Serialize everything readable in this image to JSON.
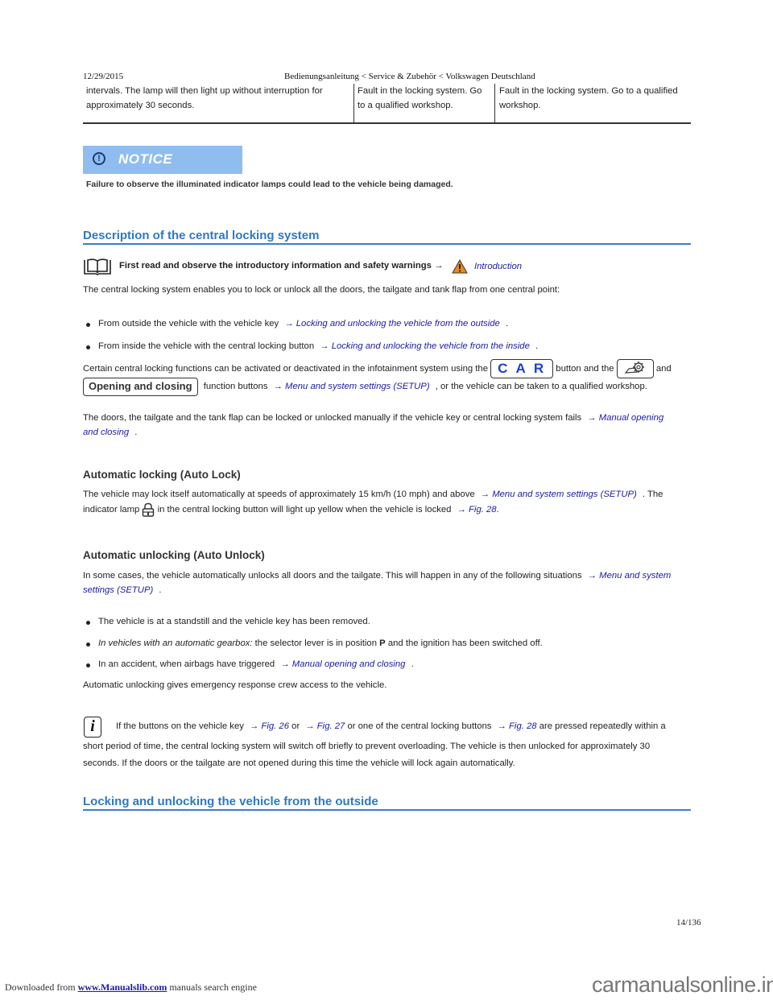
{
  "header": {
    "date": "12/29/2015",
    "title": "Bedienungsanleitung < Service & Zubehör < Volkswagen Deutschland"
  },
  "table_tail": {
    "col1": [
      "intervals. The lamp will then light up without interruption for",
      "approximately 30 seconds."
    ],
    "col2": [
      "Fault in the locking system. Go",
      "to a qualified workshop."
    ],
    "col3": [
      "Fault in the locking system. Go to a qualified",
      "workshop."
    ]
  },
  "notice": {
    "icon": "exclamation-circle-icon",
    "title": "NOTICE",
    "text": "Failure to observe the illuminated indicator lamps could lead to the vehicle being damaged.",
    "bg_color": "#8fbdf0"
  },
  "section1": {
    "heading": "Description of the central locking system",
    "read_first": {
      "icon": "book-icon",
      "text": "First read and observe the introductory information and safety warnings",
      "arrow": "→",
      "warning_icon": "warning-triangle-icon",
      "link": "Introduction"
    },
    "intro": "The central locking system enables you to lock or unlock all the doors, the tailgate and tank flap from one central point:",
    "bullets": [
      {
        "text": "From outside the vehicle with the vehicle key",
        "link": "→ Locking and unlocking the vehicle from the outside",
        "end": "."
      },
      {
        "text": "From inside the vehicle with the central locking button",
        "link": "→ Locking and unlocking the vehicle from the inside",
        "end": "."
      }
    ],
    "para_infotainment": {
      "part1": "Certain central locking functions can be activated or deactivated in the infotainment system using the",
      "car_button": "C A R",
      "part2": "button and the",
      "setup_button_icon": "car-settings-gear-icon",
      "part3": "and",
      "opening_button": "Opening and closing",
      "part4": "function buttons",
      "link": "→ Menu and system settings (SETUP)",
      "part5": ", or the vehicle can be taken to a qualified workshop."
    },
    "para_manual": {
      "text": "The doors, the tailgate and the tank flap can be locked or unlocked manually if the vehicle key or central locking system fails",
      "link_line1": "→ Manual opening",
      "link_line2": "and closing",
      "end": "."
    }
  },
  "auto_lock": {
    "heading": "Automatic locking (Auto Lock)",
    "line1": "The vehicle may lock itself automatically at speeds of approximately 15 km/h (10 mph) and above",
    "link1": "→ Menu and system settings (SETUP)",
    "line1_end": ". The",
    "line2_a": "indicator lamp",
    "lamp_icon": "padlock-icon",
    "line2_b": "in the central locking button will light up yellow when the vehicle is locked",
    "link2": "→ Fig. 28",
    "line2_end": "."
  },
  "auto_unlock": {
    "heading": "Automatic unlocking (Auto Unlock)",
    "line1": "In some cases, the vehicle automatically unlocks all doors and the tailgate. This will happen in any of the following situations",
    "link_line1": "→ Menu and system",
    "link_line2": "settings (SETUP)",
    "end": ".",
    "bullets": [
      {
        "text": "The vehicle is at a standstill and the vehicle key has been removed."
      },
      {
        "italic": "In vehicles with an automatic gearbox:",
        "text_a": " the selector lever is in position ",
        "bold": "P",
        "text_b": " and the ignition has been switched off."
      },
      {
        "text": "In an accident, when airbags have triggered",
        "link": "→ Manual opening and closing",
        "end": "."
      }
    ],
    "closing": "Automatic unlocking gives emergency response crew access to the vehicle."
  },
  "info_note": {
    "icon": "info-icon",
    "a": "If the buttons on the vehicle key",
    "link1": "→ Fig. 26",
    "b": "or",
    "link2": "→ Fig. 27",
    "c": "or one of the central locking buttons",
    "link3": "→ Fig. 28",
    "d": "are pressed repeatedly within a",
    "line2": "short period of time, the central locking system will switch off briefly to prevent overloading. The vehicle is then unlocked for approximately 30",
    "line3": "seconds. If the doors or the tailgate are not opened during this time the vehicle will lock again automatically."
  },
  "section2": {
    "heading": "Locking and unlocking the vehicle from the outside"
  },
  "page": {
    "number": "14/136"
  },
  "footer": {
    "downloaded_from": "Downloaded from",
    "site": "www.Manualslib.com",
    "suffix": "manuals search engine",
    "brand": "carmanualsonline.info"
  }
}
